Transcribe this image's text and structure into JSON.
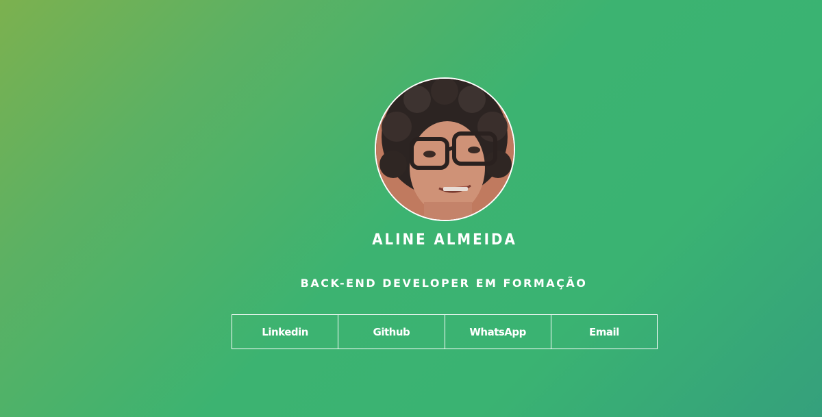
{
  "profile": {
    "name": "ALINE ALMEIDA",
    "role": "BACK-END DEVELOPER EM FORMAÇÃO"
  },
  "links": [
    {
      "label": "Linkedin"
    },
    {
      "label": "Github"
    },
    {
      "label": "WhatsApp"
    },
    {
      "label": "Email"
    }
  ],
  "colors": {
    "gradient_start": "#7cb14f",
    "gradient_mid": "#3cb371",
    "gradient_end": "#35a07c",
    "text": "#ffffff"
  }
}
